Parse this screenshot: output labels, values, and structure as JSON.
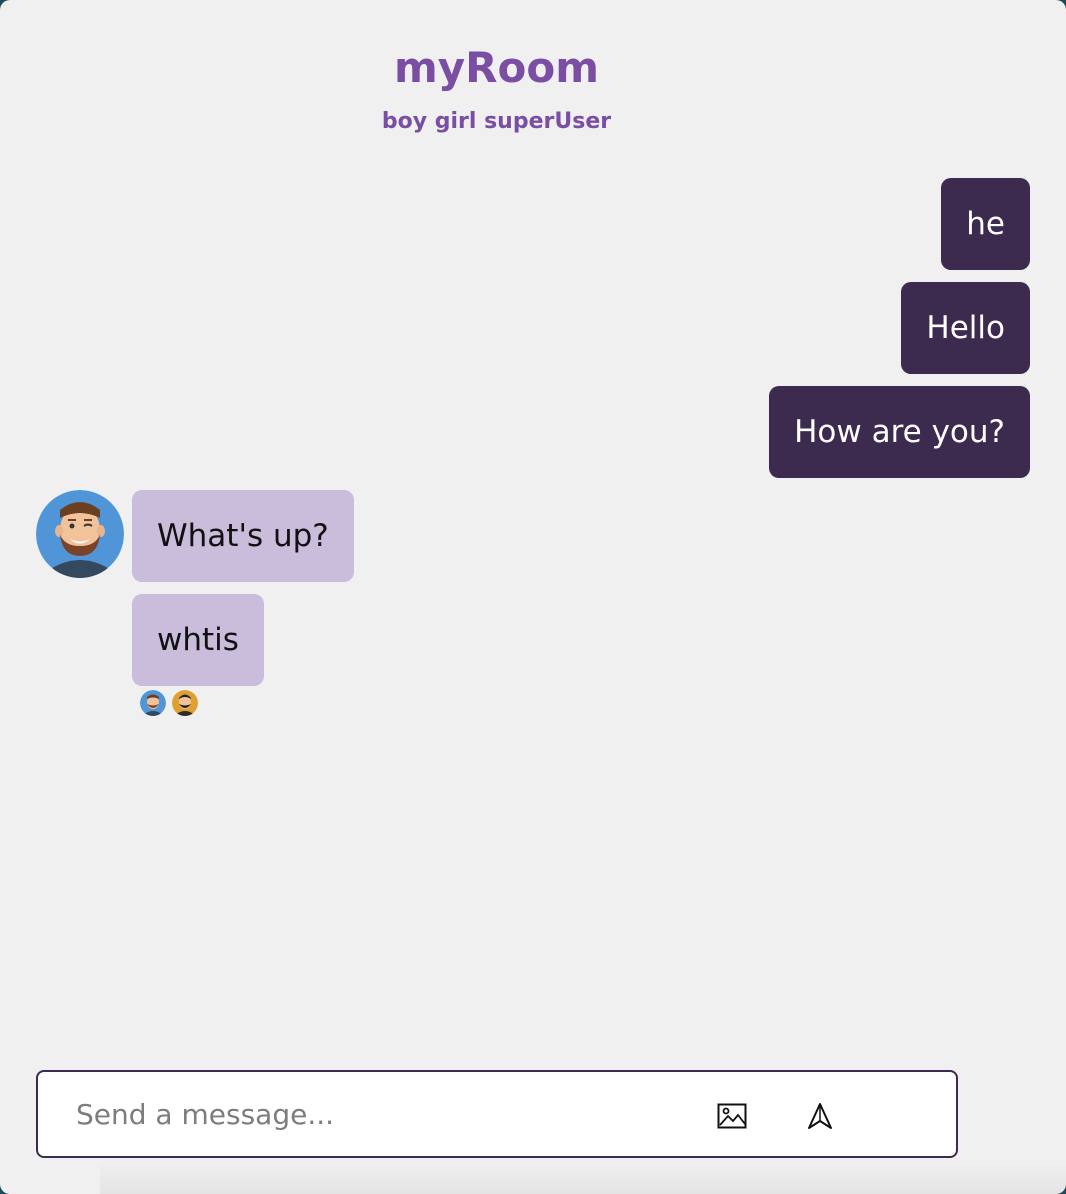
{
  "room": {
    "title": "myRoom",
    "members": "boy girl superUser"
  },
  "messages": {
    "m1": {
      "text": "he",
      "sender": "self"
    },
    "m2": {
      "text": "Hello",
      "sender": "self"
    },
    "m3": {
      "text": "How are you?",
      "sender": "self"
    },
    "m4": {
      "text": "What's up?",
      "sender": "other"
    },
    "m5": {
      "text": "whtis",
      "sender": "other"
    }
  },
  "composer": {
    "placeholder": "Send a message...",
    "image_icon": "image-icon",
    "send_icon": "send-icon"
  },
  "colors": {
    "accent": "#7a4ea3",
    "own_bubble": "#3d2a4f",
    "other_bubble": "#cabddc",
    "background": "#f0f0f1"
  }
}
